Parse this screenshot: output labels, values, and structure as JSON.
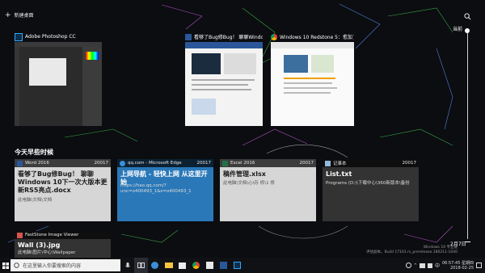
{
  "desktop": {
    "new_desktop_label": "新建桌面"
  },
  "windows": [
    {
      "app": "Adobe Photoshop CC",
      "icon": "photoshop-icon"
    },
    {
      "app": "看够了Bug修Bug！ 聊聊Windows 1...",
      "icon": "word-icon"
    },
    {
      "app": "Windows 10 Redstone 5：愈加了...",
      "icon": "chrome-icon"
    }
  ],
  "timeline": {
    "now_label": "当前",
    "date_label": "2月7日",
    "section_title": "今天早些时候",
    "cards": [
      {
        "app": "Word 2016",
        "count": "20017",
        "title": "看够了Bug修Bug！ 聊聊 Windows 10下一次大版本更新RS5亮点.docx",
        "sub": "此电脑\\文档\\文档"
      },
      {
        "app": "qq.com - Microsoft Edge",
        "count": "20017",
        "title": "上网导航 - 轻快上网 从这里开始",
        "sub": "https://hao.qq.com/?unc=o400493_1&s=o400493_1"
      },
      {
        "app": "Excel 2016",
        "count": "20017",
        "title": "稿件管理.xlsx",
        "sub": "此电脑\\文档\\心\\存 修\\1 修"
      },
      {
        "app": "记事本",
        "count": "20017",
        "title": "List.txt",
        "sub": "Programs (D:)\\下载中心\\360新版本\\备份"
      },
      {
        "app": "FastStone Image Viewer",
        "count": "",
        "title": "Wall (3).jpg",
        "sub": "此电脑\\图片\\中心\\Wallpaper"
      }
    ]
  },
  "taskbar": {
    "search_placeholder": "在这里输入你要搜索的内容",
    "time": "06:57:45 星期四",
    "date": "2018-02-25"
  },
  "watermark": {
    "line1": "Windows 10 专业版",
    "line2": "评估副本。Build 17101.rs_prerelease.180211-1040"
  },
  "colors": {
    "accent": "#2a78b8",
    "card": "#d6d6d6",
    "taskbar": "#101114"
  }
}
